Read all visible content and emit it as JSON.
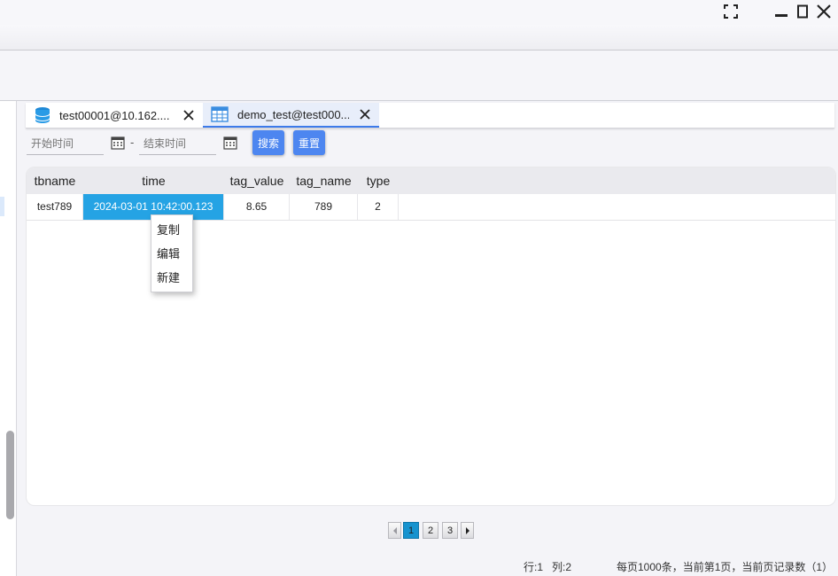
{
  "tabs": [
    {
      "label": "test00001@10.162....",
      "icon": "database-icon"
    },
    {
      "label": "demo_test@test000...",
      "icon": "table-icon",
      "active": true
    }
  ],
  "filter": {
    "start_placeholder": "开始时间",
    "end_placeholder": "结束时间",
    "separator": "-",
    "search_label": "搜索",
    "reset_label": "重置"
  },
  "table": {
    "columns": [
      "tbname",
      "time",
      "tag_value",
      "tag_name",
      "type"
    ],
    "rows": [
      [
        "test789",
        "2024-03-01 10:42:00.123",
        "8.65",
        "789",
        "2"
      ]
    ],
    "selected_cell": {
      "row": 0,
      "column": 1
    }
  },
  "context_menu": {
    "items": [
      "复制",
      "编辑",
      "新建"
    ]
  },
  "pagination": {
    "pages": [
      "1",
      "2",
      "3"
    ],
    "current": "1"
  },
  "status": {
    "row_col": "行:1   列:2",
    "summary": "每页1000条，当前第1页，当前页记录数（1）"
  },
  "colors": {
    "accent": "#4d86f0",
    "selection": "#25a3e4",
    "active_page": "#1693cf"
  }
}
